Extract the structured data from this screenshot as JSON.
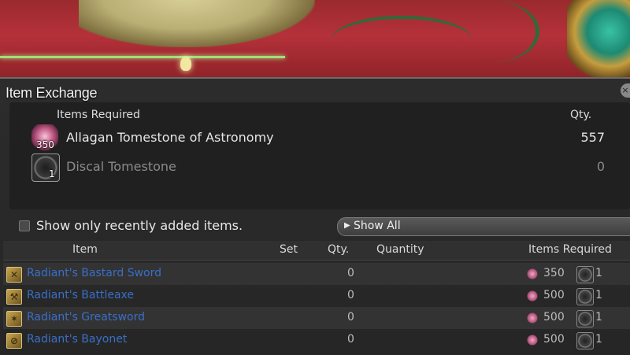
{
  "window": {
    "title": "Item Exchange"
  },
  "required_panel": {
    "header_items": "Items Required",
    "header_qty": "Qty.",
    "currencies": [
      {
        "icon": "astronomy-tomestone-icon",
        "count": "350",
        "name": "Allagan Tomestone of Astronomy",
        "qty": "557"
      },
      {
        "icon": "discal-tomestone-icon",
        "count": "1",
        "name": "Discal Tomestone",
        "qty": "0"
      }
    ]
  },
  "filter": {
    "checkbox_label": "Show only recently added items.",
    "checked": false,
    "dropdown_label": "Show All"
  },
  "list": {
    "headers": {
      "item": "Item",
      "set": "Set",
      "qty": "Qty.",
      "quantity": "Quantity",
      "items_required": "Items Required"
    },
    "rows": [
      {
        "name": "Radiant's Bastard Sword",
        "icon": "sword-icon",
        "qty": "0",
        "cost1": "350",
        "cost2": "1"
      },
      {
        "name": "Radiant's Battleaxe",
        "icon": "axe-icon",
        "qty": "0",
        "cost1": "500",
        "cost2": "1"
      },
      {
        "name": "Radiant's Greatsword",
        "icon": "greatsword-icon",
        "qty": "0",
        "cost1": "500",
        "cost2": "1"
      },
      {
        "name": "Radiant's Bayonet",
        "icon": "gunblade-icon",
        "qty": "0",
        "cost1": "500",
        "cost2": "1"
      }
    ]
  },
  "colors": {
    "item_link": "#3a6fc8",
    "progress_bar": "#9de07a"
  }
}
